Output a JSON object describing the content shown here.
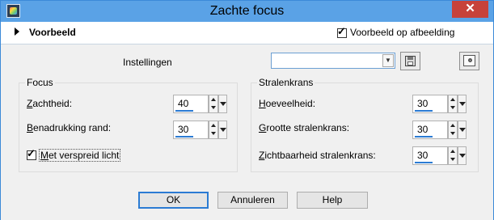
{
  "window": {
    "title": "Zachte focus",
    "close_glyph": "✕"
  },
  "toolbar": {
    "preview_label": "Voorbeeld",
    "preview_on_image_label": "Voorbeeld op afbeelding",
    "preview_on_image_checked": true
  },
  "settings": {
    "label": "Instellingen",
    "preset_value": ""
  },
  "focus": {
    "title": "Focus",
    "softness": {
      "accel": "Z",
      "rest": "achtheid:",
      "value": "40"
    },
    "edge_emphasis": {
      "accel": "B",
      "rest": "enadrukking rand:",
      "value": "30"
    },
    "diffuse_light": {
      "accel": "M",
      "rest": "et verspreid licht",
      "checked": true
    }
  },
  "halo": {
    "title": "Stralenkrans",
    "amount": {
      "accel": "H",
      "rest": "oeveelheid:",
      "value": "30"
    },
    "size": {
      "accel": "G",
      "rest": "rootte stralenkrans:",
      "value": "30"
    },
    "visibility": {
      "accel": "Z",
      "rest": "ichtbaarheid stralenkrans:",
      "value": "30"
    }
  },
  "buttons": {
    "ok": "OK",
    "cancel": "Annuleren",
    "help": "Help"
  },
  "colors": {
    "titlebar": "#5aa2e6",
    "close": "#c7423a",
    "panel": "#f0f0f0",
    "accent": "#2b7bd3"
  },
  "icons": [
    "app-icon",
    "close-icon",
    "expand-triangle-icon",
    "save-preset-icon",
    "manage-presets-icon",
    "chevron-down-icon",
    "spin-arrows-icon"
  ]
}
